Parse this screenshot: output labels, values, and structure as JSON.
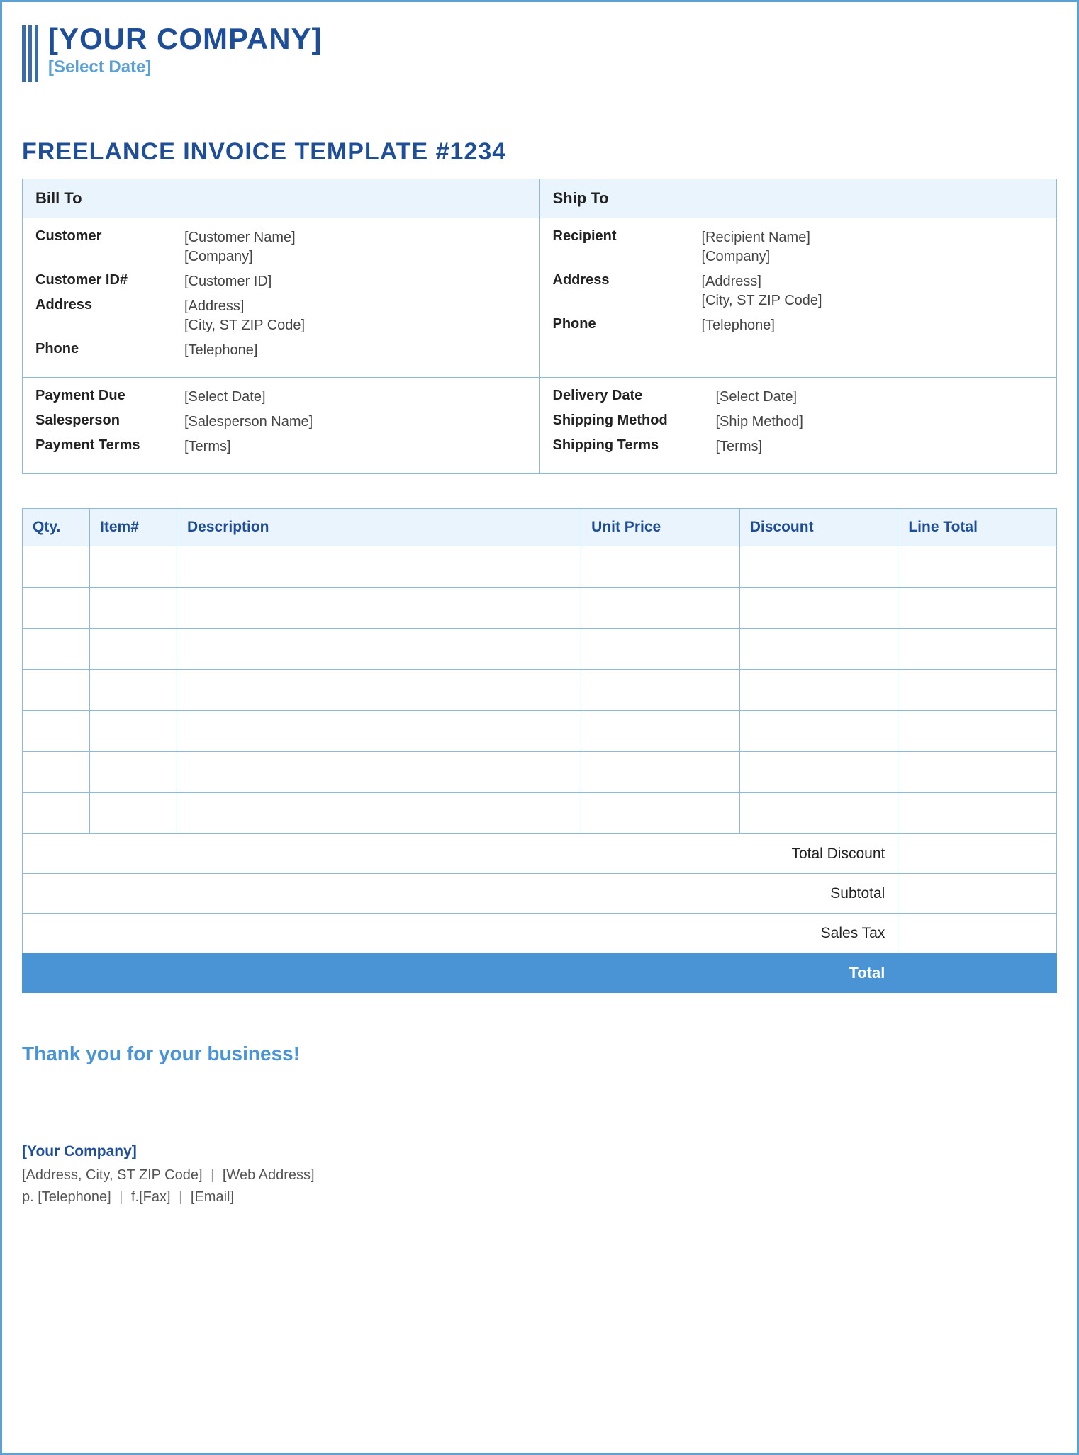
{
  "header": {
    "company": "[YOUR COMPANY]",
    "date": "[Select Date]"
  },
  "title": "FREELANCE INVOICE TEMPLATE #1234",
  "billTo": {
    "heading": "Bill To",
    "customerLabel": "Customer",
    "customerName": "[Customer Name]",
    "customerCompany": "[Company]",
    "customerIdLabel": "Customer ID#",
    "customerId": "[Customer ID]",
    "addressLabel": "Address",
    "address1": "[Address]",
    "address2": "[City, ST  ZIP Code]",
    "phoneLabel": "Phone",
    "phone": "[Telephone]"
  },
  "shipTo": {
    "heading": "Ship To",
    "recipientLabel": "Recipient",
    "recipientName": "[Recipient Name]",
    "recipientCompany": "[Company]",
    "addressLabel": "Address",
    "address1": "[Address]",
    "address2": "[City, ST  ZIP Code]",
    "phoneLabel": "Phone",
    "phone": "[Telephone]"
  },
  "payment": {
    "paymentDueLabel": "Payment Due",
    "paymentDue": "[Select Date]",
    "salespersonLabel": "Salesperson",
    "salesperson": "[Salesperson Name]",
    "paymentTermsLabel": "Payment Terms",
    "paymentTerms": "[Terms]"
  },
  "delivery": {
    "deliveryDateLabel": "Delivery Date",
    "deliveryDate": "[Select Date]",
    "shippingMethodLabel": "Shipping Method",
    "shippingMethod": "[Ship Method]",
    "shippingTermsLabel": "Shipping Terms",
    "shippingTerms": "[Terms]"
  },
  "lineHeaders": {
    "qty": "Qty.",
    "item": "Item#",
    "desc": "Description",
    "price": "Unit Price",
    "discount": "Discount",
    "total": "Line Total"
  },
  "summary": {
    "totalDiscount": "Total Discount",
    "subtotal": "Subtotal",
    "salesTax": "Sales Tax",
    "total": "Total"
  },
  "thanks": "Thank you for your business!",
  "footer": {
    "company": "[Your Company]",
    "address": "[Address, City, ST  ZIP Code]",
    "web": "[Web Address]",
    "phonePrefix": "p.",
    "phone": "[Telephone]",
    "faxPrefix": "f.",
    "fax": "[Fax]",
    "email": "[Email]"
  }
}
